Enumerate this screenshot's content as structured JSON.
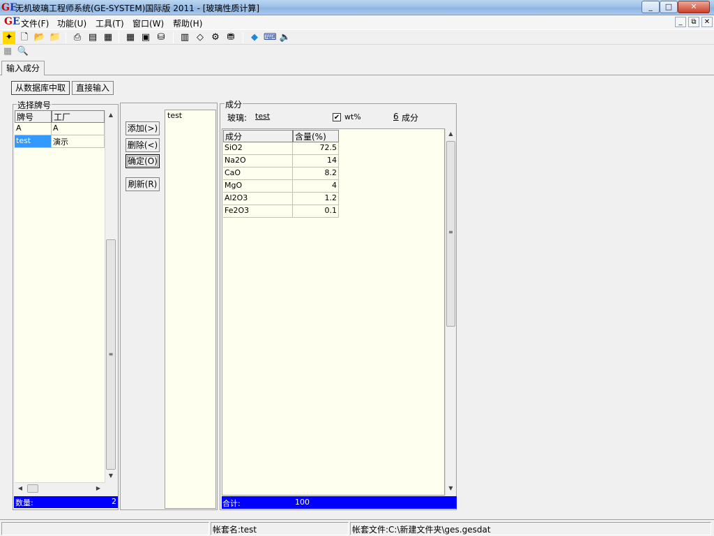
{
  "window": {
    "logo_g": "G",
    "logo_e": "E",
    "title": "无机玻璃工程师系统(GE-SYSTEM)国际版 2011 - [玻璃性质计算]",
    "minimize": "_",
    "maximize": "□",
    "close": "✕"
  },
  "menu": {
    "items": [
      "文件(F)",
      "功能(U)",
      "工具(T)",
      "窗口(W)",
      "帮助(H)"
    ],
    "mdi_minimize": "_",
    "mdi_restore": "⧉",
    "mdi_close": "✕"
  },
  "tabs": {
    "input": "输入成分"
  },
  "source": {
    "from_db": "从数据库中取",
    "direct": "直接输入"
  },
  "select_brand": {
    "label": "选择牌号",
    "columns": [
      "牌号",
      "工厂"
    ],
    "rows": [
      [
        "A",
        "A"
      ],
      [
        "test",
        "演示"
      ]
    ],
    "count_label": "数量:",
    "count_value": "2"
  },
  "actions": {
    "add": "添加(>)",
    "delete": "删除(<)",
    "confirm": "确定(O)",
    "refresh": "刷新(R)"
  },
  "selected_list": {
    "items": [
      "test"
    ]
  },
  "composition": {
    "label": "成分",
    "glass_label": "玻璃:",
    "glass_name": "test",
    "wt_checked": "✔",
    "wt_label": "wt%",
    "count": "6",
    "count_label": "成分",
    "columns": [
      "成分",
      "含量(%)"
    ],
    "rows": [
      [
        "SiO2",
        "72.5"
      ],
      [
        "Na2O",
        "14"
      ],
      [
        "CaO",
        "8.2"
      ],
      [
        "MgO",
        "4"
      ],
      [
        "Al2O3",
        "1.2"
      ],
      [
        "Fe2O3",
        "0.1"
      ]
    ],
    "total_label": "合计:",
    "total_value": "100"
  },
  "status": {
    "account_name": "帐套名:test",
    "account_file": "帐套文件:C:\\新建文件夹\\ges.gesdat"
  },
  "colors": {
    "selection": "#3399ff",
    "grid_bg": "#fffff0",
    "total_bar": "#0000ff"
  }
}
